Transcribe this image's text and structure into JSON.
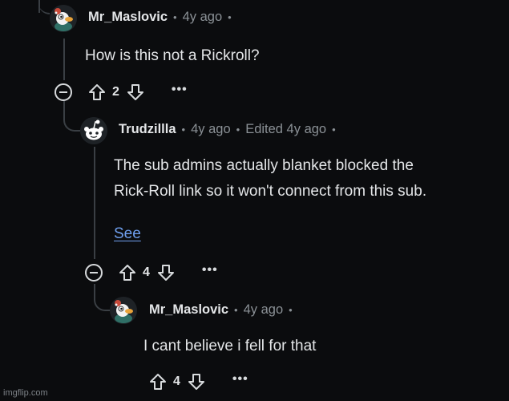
{
  "colors": {
    "background": "#0b0c0e",
    "text": "#e4e6e8",
    "muted": "#8b9196",
    "link": "#6f9fee",
    "thread_line": "#3a3f44"
  },
  "comments": [
    {
      "username": "Mr_Maslovic",
      "separator": "•",
      "age": "4y ago",
      "edited": "",
      "body": [
        "How is this not a Rickroll?"
      ],
      "link": "",
      "score": "2",
      "more_label": "•••",
      "avatar": "duck-avatar-icon"
    },
    {
      "username": "Trudzillla",
      "separator": "•",
      "age": "4y ago",
      "edited": "Edited 4y ago",
      "body": [
        "The sub admins actually blanket blocked the",
        "Rick-Roll link so it won't connect from this sub."
      ],
      "link": "See",
      "score": "4",
      "more_label": "•••",
      "avatar": "snoo-avatar-icon"
    },
    {
      "username": "Mr_Maslovic",
      "separator": "•",
      "age": "4y ago",
      "edited": "",
      "body": [
        "I cant believe i fell for that"
      ],
      "link": "",
      "score": "4",
      "more_label": "•••",
      "avatar": "duck-avatar-icon"
    }
  ],
  "watermark": "imgflip.com"
}
